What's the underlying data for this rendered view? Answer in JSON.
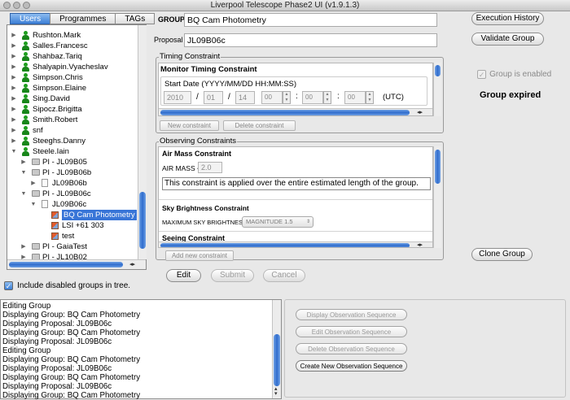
{
  "window": {
    "title": "Liverpool Telescope Phase2 UI (v1.9.1.3)"
  },
  "tabs": [
    {
      "label": "Users",
      "selected": true
    },
    {
      "label": "Programmes",
      "selected": false
    },
    {
      "label": "TAGs",
      "selected": false
    }
  ],
  "tree": {
    "nodes": [
      {
        "label": "Rushton.Mark",
        "type": "user"
      },
      {
        "label": "Salles.Francesc",
        "type": "user"
      },
      {
        "label": "Shahbaz.Tariq",
        "type": "user"
      },
      {
        "label": "Shalyapin.Vyacheslav",
        "type": "user"
      },
      {
        "label": "Simpson.Chris",
        "type": "user"
      },
      {
        "label": "Simpson.Elaine",
        "type": "user"
      },
      {
        "label": "Sing.David",
        "type": "user"
      },
      {
        "label": "Sipocz.Brigitta",
        "type": "user"
      },
      {
        "label": "Smith.Robert",
        "type": "user"
      },
      {
        "label": "snf",
        "type": "user"
      },
      {
        "label": "Steeghs.Danny",
        "type": "user"
      },
      {
        "label": "Steele.Iain",
        "type": "user"
      },
      {
        "label": "PI - JL09B05",
        "type": "programme"
      },
      {
        "label": "PI - JL09B06b",
        "type": "programme"
      },
      {
        "label": "JL09B06b",
        "type": "proposal"
      },
      {
        "label": "PI - JL09B06c",
        "type": "programme"
      },
      {
        "label": "JL09B06c",
        "type": "proposal"
      },
      {
        "label": "BQ Cam Photometry",
        "type": "group",
        "selected": true
      },
      {
        "label": "LSI +61 303",
        "type": "group"
      },
      {
        "label": "test",
        "type": "group"
      },
      {
        "label": "PI - GaiaTest",
        "type": "programme"
      },
      {
        "label": "PI - JL10B02",
        "type": "programme"
      }
    ]
  },
  "include_disabled": {
    "label": "Include disabled groups in tree.",
    "checked": true
  },
  "group": {
    "group_label": "GROUP",
    "group_value": "BQ Cam Photometry",
    "proposal_label": "Proposal",
    "proposal_value": "JL09B06c"
  },
  "timing": {
    "title": "Timing Constraint",
    "heading": "Monitor Timing Constraint",
    "start_label": "Start Date (YYYY/MM/DD HH:MM:SS)",
    "year": "2010",
    "month": "01",
    "day": "14",
    "hour": "00",
    "minute": "00",
    "second": "00",
    "sep_date": "/",
    "sep_time": ":",
    "tz": "(UTC)",
    "new_btn": "New constraint",
    "delete_btn": "Delete constraint"
  },
  "observing": {
    "title": "Observing Constraints",
    "airmass_heading": "Air Mass Constraint",
    "airmass_label": "AIR MASS <",
    "airmass_value": "2.0",
    "airmass_note": "This constraint is applied over the entire estimated length of the group.",
    "sky_heading": "Sky Brightness Constraint",
    "sky_label": "MAXIMUM SKY BRIGHTNESS=",
    "sky_value": "MAGNITUDE 1.5",
    "seeing_heading": "Seeing Constraint",
    "add_btn": "Add new constraint"
  },
  "actions": {
    "edit": "Edit",
    "submit": "Submit",
    "cancel": "Cancel"
  },
  "right": {
    "execution_history": "Execution History",
    "validate_group": "Validate Group",
    "group_enabled": "Group is enabled",
    "status": "Group expired",
    "clone_group": "Clone Group"
  },
  "log": {
    "lines": [
      "Editing Group",
      "Displaying Group: BQ Cam Photometry",
      "Displaying Proposal: JL09B06c",
      "Displaying Group: BQ Cam Photometry",
      "Displaying Proposal: JL09B06c",
      "Editing Group",
      "Displaying Group: BQ Cam Photometry",
      "Displaying Proposal: JL09B06c",
      "Displaying Group: BQ Cam Photometry",
      "Displaying Proposal: JL09B06c",
      "Displaying Group: BQ Cam Photometry"
    ]
  },
  "obs_seq": {
    "display": "Display Observation Sequence",
    "edit": "Edit Observation Sequence",
    "delete": "Delete Observation Sequence",
    "create": "Create New Observation Sequence"
  },
  "icons": {
    "user": "user-icon",
    "programme": "folder-icon",
    "proposal": "document-icon",
    "group": "observation-group-icon"
  },
  "colors": {
    "selection": "#3875d7",
    "tab_selected": "#3d7fd6",
    "user_icon": "#1d9e1d"
  }
}
